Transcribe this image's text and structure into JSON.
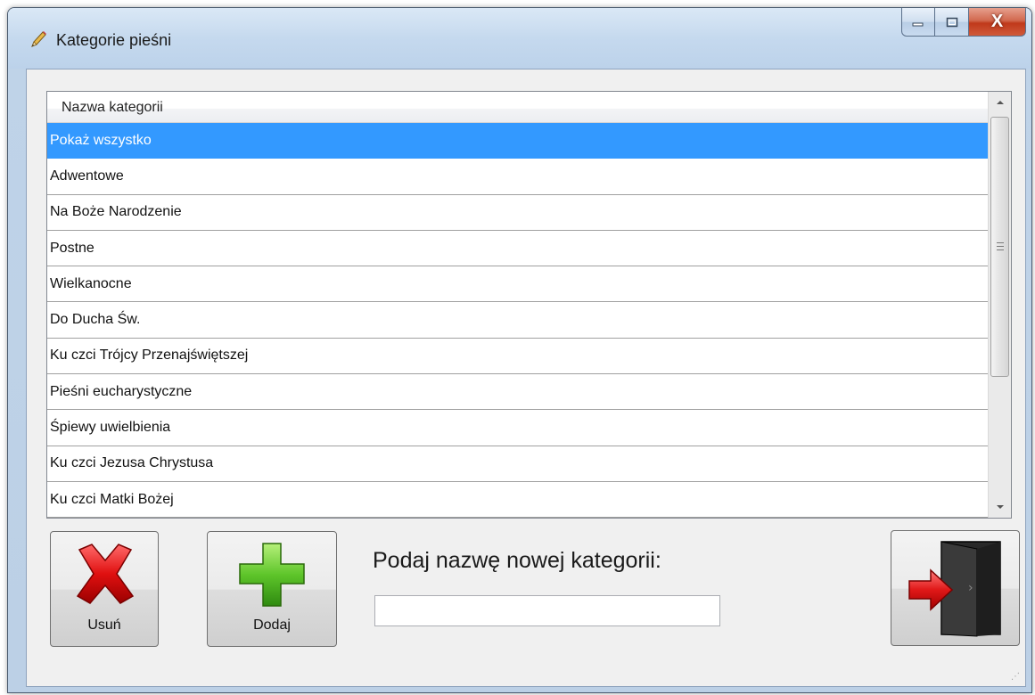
{
  "window": {
    "title": "Kategorie pieśni",
    "icon": "pencil-icon",
    "caption_buttons": {
      "minimize_icon": "minimize-icon",
      "maximize_icon": "maximize-icon",
      "close_icon": "close-icon",
      "close_glyph": "X"
    }
  },
  "list": {
    "column_header": "Nazwa kategorii",
    "selected_index": 0,
    "selection_color": "#3399ff",
    "rows": [
      "Pokaż wszystko",
      "Adwentowe",
      "Na Boże Narodzenie",
      "Postne",
      "Wielkanocne",
      "Do Ducha Św.",
      "Ku czci Trójcy Przenajświętszej",
      "Pieśni eucharystyczne",
      "Śpiewy uwielbienia",
      "Ku czci Jezusa Chrystusa",
      "Ku czci Matki Bożej"
    ]
  },
  "actions": {
    "delete_label": "Usuń",
    "delete_icon": "red-x-icon",
    "add_label": "Dodaj",
    "add_icon": "green-plus-icon",
    "exit_icon": "exit-door-icon"
  },
  "new_category": {
    "prompt": "Podaj nazwę nowej kategorii:",
    "value": "",
    "placeholder": ""
  }
}
